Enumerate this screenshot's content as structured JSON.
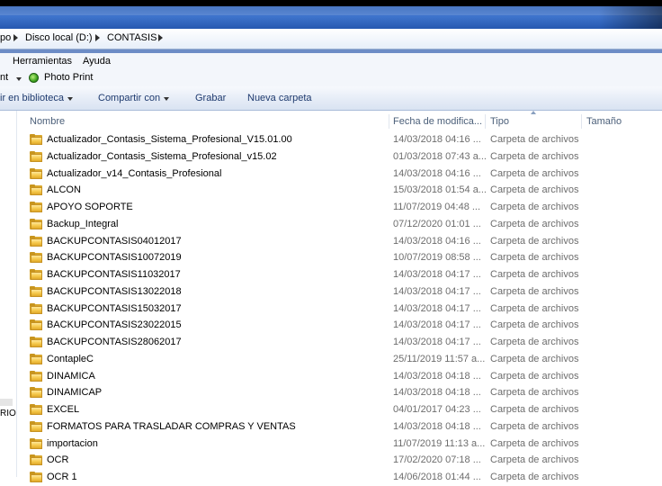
{
  "address_bar": {
    "crumbs": [
      "po",
      "Disco local (D:)",
      "CONTASIS"
    ]
  },
  "menu": {
    "items": [
      "Herramientas",
      "Ayuda"
    ]
  },
  "links_bar": {
    "prefix": "nt",
    "item": "Photo Print"
  },
  "command_bar": {
    "include": "ir en biblioteca",
    "share": "Compartir con",
    "burn": "Grabar",
    "new_folder": "Nueva carpeta"
  },
  "columns": {
    "name": "Nombre",
    "date": "Fecha de modifica...",
    "type": "Tipo",
    "size": "Tamaño"
  },
  "nav_pane": {
    "clipped_text": "RIO"
  },
  "files": [
    {
      "name": "Actualizador_Contasis_Sistema_Profesional_V15.01.00",
      "date": "14/03/2018 04:16 ...",
      "type": "Carpeta de archivos"
    },
    {
      "name": "Actualizador_Contasis_Sistema_Profesional_v15.02",
      "date": "01/03/2018 07:43 a...",
      "type": "Carpeta de archivos"
    },
    {
      "name": "Actualizador_v14_Contasis_Profesional",
      "date": "14/03/2018 04:16 ...",
      "type": "Carpeta de archivos"
    },
    {
      "name": "ALCON",
      "date": "15/03/2018 01:54 a...",
      "type": "Carpeta de archivos"
    },
    {
      "name": "APOYO SOPORTE",
      "date": "11/07/2019 04:48 ...",
      "type": "Carpeta de archivos"
    },
    {
      "name": "Backup_Integral",
      "date": "07/12/2020 01:01 ...",
      "type": "Carpeta de archivos"
    },
    {
      "name": "BACKUPCONTASIS04012017",
      "date": "14/03/2018 04:16 ...",
      "type": "Carpeta de archivos"
    },
    {
      "name": "BACKUPCONTASIS10072019",
      "date": "10/07/2019 08:58 ...",
      "type": "Carpeta de archivos"
    },
    {
      "name": "BACKUPCONTASIS11032017",
      "date": "14/03/2018 04:17 ...",
      "type": "Carpeta de archivos"
    },
    {
      "name": "BACKUPCONTASIS13022018",
      "date": "14/03/2018 04:17 ...",
      "type": "Carpeta de archivos"
    },
    {
      "name": "BACKUPCONTASIS15032017",
      "date": "14/03/2018 04:17 ...",
      "type": "Carpeta de archivos"
    },
    {
      "name": "BACKUPCONTASIS23022015",
      "date": "14/03/2018 04:17 ...",
      "type": "Carpeta de archivos"
    },
    {
      "name": "BACKUPCONTASIS28062017",
      "date": "14/03/2018 04:17 ...",
      "type": "Carpeta de archivos"
    },
    {
      "name": "ContapleC",
      "date": "25/11/2019 11:57 a...",
      "type": "Carpeta de archivos"
    },
    {
      "name": "DINAMICA",
      "date": "14/03/2018 04:18 ...",
      "type": "Carpeta de archivos"
    },
    {
      "name": "DINAMICAP",
      "date": "14/03/2018 04:18 ...",
      "type": "Carpeta de archivos"
    },
    {
      "name": "EXCEL",
      "date": "04/01/2017 04:23 ...",
      "type": "Carpeta de archivos"
    },
    {
      "name": "FORMATOS PARA TRASLADAR COMPRAS Y VENTAS",
      "date": "14/03/2018 04:18 ...",
      "type": "Carpeta de archivos"
    },
    {
      "name": "importacion",
      "date": "11/07/2019 11:13 a...",
      "type": "Carpeta de archivos"
    },
    {
      "name": "OCR",
      "date": "17/02/2020 07:18 ...",
      "type": "Carpeta de archivos"
    },
    {
      "name": "OCR 1",
      "date": "14/06/2018 01:44 ...",
      "type": "Carpeta de archivos"
    }
  ]
}
